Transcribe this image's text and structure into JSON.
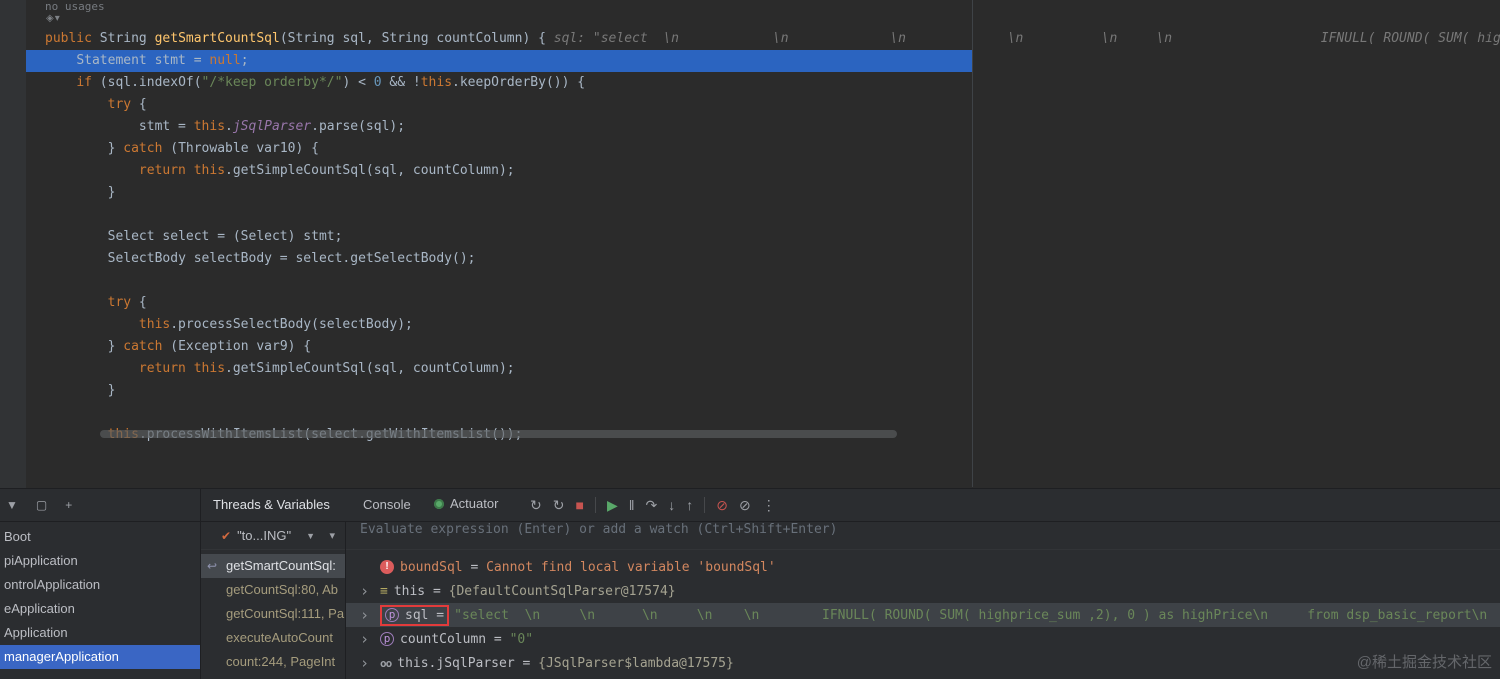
{
  "editor": {
    "no_usages": "no usages",
    "lines": [
      {
        "ind": 0,
        "seg": [
          [
            "k",
            "public "
          ],
          [
            "p",
            "String "
          ],
          [
            "m",
            "getSmartCountSql"
          ],
          [
            "p",
            "(String sql, String countColumn) { "
          ],
          [
            "h",
            "sql: \"select  \\n            \\n             \\n             \\n          \\n     \\n                   IFNULL( ROUND( SUM( hig"
          ]
        ]
      },
      {
        "ind": 1,
        "hl": true,
        "seg": [
          [
            "p",
            "Statement stmt = "
          ],
          [
            "k",
            "null"
          ],
          [
            "p",
            ";"
          ]
        ]
      },
      {
        "ind": 1,
        "seg": [
          [
            "k",
            "if "
          ],
          [
            "p",
            "(sql.indexOf("
          ],
          [
            "s",
            "\"/*keep orderby*/\""
          ],
          [
            "p",
            ") < "
          ],
          [
            "n",
            "0"
          ],
          [
            "p",
            " && !"
          ],
          [
            "k",
            "this"
          ],
          [
            "p",
            ".keepOrderBy()) {"
          ]
        ]
      },
      {
        "ind": 2,
        "seg": [
          [
            "k",
            "try"
          ],
          [
            "p",
            " {"
          ]
        ]
      },
      {
        "ind": 3,
        "seg": [
          [
            "p",
            "stmt = "
          ],
          [
            "k",
            "this"
          ],
          [
            "p",
            "."
          ],
          [
            "f",
            "jSqlParser"
          ],
          [
            "p",
            ".parse(sql);"
          ]
        ]
      },
      {
        "ind": 2,
        "seg": [
          [
            "p",
            "} "
          ],
          [
            "k",
            "catch"
          ],
          [
            "p",
            " (Throwable var10) {"
          ]
        ]
      },
      {
        "ind": 3,
        "seg": [
          [
            "k",
            "return "
          ],
          [
            "k",
            "this"
          ],
          [
            "p",
            ".getSimpleCountSql(sql, countColumn);"
          ]
        ]
      },
      {
        "ind": 2,
        "seg": [
          [
            "p",
            "}"
          ]
        ]
      },
      {
        "ind": 0,
        "seg": []
      },
      {
        "ind": 2,
        "seg": [
          [
            "p",
            "Select select = (Select) stmt;"
          ]
        ]
      },
      {
        "ind": 2,
        "seg": [
          [
            "p",
            "SelectBody selectBody = select.getSelectBody();"
          ]
        ]
      },
      {
        "ind": 0,
        "seg": []
      },
      {
        "ind": 2,
        "seg": [
          [
            "k",
            "try"
          ],
          [
            "p",
            " {"
          ]
        ]
      },
      {
        "ind": 3,
        "seg": [
          [
            "k",
            "this"
          ],
          [
            "p",
            ".processSelectBody(selectBody);"
          ]
        ]
      },
      {
        "ind": 2,
        "seg": [
          [
            "p",
            "} "
          ],
          [
            "k",
            "catch"
          ],
          [
            "p",
            " (Exception var9) {"
          ]
        ]
      },
      {
        "ind": 3,
        "seg": [
          [
            "k",
            "return "
          ],
          [
            "k",
            "this"
          ],
          [
            "p",
            ".getSimpleCountSql(sql, countColumn);"
          ]
        ]
      },
      {
        "ind": 2,
        "seg": [
          [
            "p",
            "}"
          ]
        ]
      },
      {
        "ind": 0,
        "seg": []
      },
      {
        "ind": 2,
        "seg": [
          [
            "k",
            "this"
          ],
          [
            "p",
            ".processWithItemsList(select.getWithItemsList());"
          ]
        ]
      }
    ]
  },
  "services": {
    "toolbar_icons": [
      {
        "name": "filter-icon",
        "glyph": "▼"
      },
      {
        "name": "new-window-icon",
        "glyph": "▢"
      },
      {
        "name": "add-service-icon",
        "glyph": "+"
      }
    ],
    "items": [
      "Boot",
      "piApplication",
      "ontrolApplication",
      "eApplication",
      "Application",
      "managerApplication"
    ],
    "selected_index": 5
  },
  "debug": {
    "tabs": [
      "Threads & Variables",
      "Console"
    ],
    "actuator_label": "Actuator",
    "toolbar_icons": [
      {
        "name": "rerun-icon",
        "glyph": "↻",
        "color": "#9da0a6"
      },
      {
        "name": "rerun-debug-icon",
        "glyph": "↻",
        "color": "#9da0a6"
      },
      {
        "name": "stop-icon",
        "glyph": "■",
        "color": "#c75450"
      },
      {
        "sep": true
      },
      {
        "name": "resume-icon",
        "glyph": "▶",
        "color": "#59a869"
      },
      {
        "name": "pause-icon",
        "glyph": "‖",
        "color": "#9da0a6"
      },
      {
        "name": "step-over-icon",
        "glyph": "↷",
        "color": "#9da0a6"
      },
      {
        "name": "step-into-icon",
        "glyph": "↓",
        "color": "#9da0a6"
      },
      {
        "name": "step-out-icon",
        "glyph": "↑",
        "color": "#9da0a6"
      },
      {
        "sep": true
      },
      {
        "name": "mute-breakpoints-icon",
        "glyph": "⊘",
        "color": "#c75450"
      },
      {
        "name": "disable-renderers-icon",
        "glyph": "⊘",
        "color": "#9da0a6"
      },
      {
        "name": "more-options-icon",
        "glyph": "⋮",
        "color": "#9da0a6"
      }
    ],
    "thread": {
      "status_icon": "✔",
      "label": "\"to...ING\""
    },
    "frames": [
      {
        "label": "getSmartCountSql:",
        "current": true
      },
      {
        "label": "getCountSql:80, Ab"
      },
      {
        "label": "getCountSql:111, Pa"
      },
      {
        "label": "executeAutoCount"
      },
      {
        "label": "count:244, PageInt"
      }
    ],
    "evaluate_placeholder": "Evaluate expression (Enter) or add a watch (Ctrl+Shift+Enter)",
    "variables": [
      {
        "icon": "error",
        "name": "boundSql",
        "error": "Cannot find local variable 'boundSql'"
      },
      {
        "expand": true,
        "icon": "this",
        "name": "this",
        "value": "{DefaultCountSqlParser@17574}"
      },
      {
        "expand": true,
        "icon": "param",
        "name": "sql",
        "red_box": true,
        "highlighted": true,
        "str": "\"select  \\n     \\n      \\n     \\n    \\n        IFNULL( ROUND( SUM( highprice_sum ,2), 0 ) as highPrice\\n     from dsp_basic_report\\n   \\n   \\n"
      },
      {
        "expand": true,
        "icon": "param",
        "name": "countColumn",
        "str": "\"0\""
      },
      {
        "expand": true,
        "icon": "watch",
        "name": "this.jSqlParser",
        "value": "{JSqlParser$lambda@17575}"
      }
    ]
  },
  "watermark": "@稀土掘金技术社区",
  "colors": {
    "execution_line_blue": "#2b64c0",
    "selection_blue": "#3a66c4",
    "error_red": "#db5c5c",
    "annotation_red": "#e23b3b",
    "string_green": "#6a8759",
    "keyword_orange": "#cc7832",
    "stop_red": "#c75450",
    "resume_green": "#59a869"
  }
}
